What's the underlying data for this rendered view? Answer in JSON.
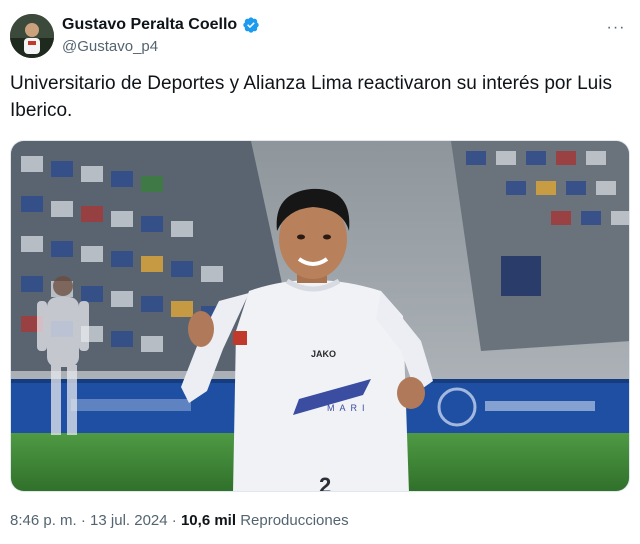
{
  "author": {
    "display_name": "Gustavo Peralta Coello",
    "handle": "@Gustavo_p4",
    "avatar_icon": "avatar",
    "verified_icon": "verified-badge-icon",
    "verified_color": "#1d9bf0"
  },
  "more_icon": "more-options-icon",
  "tweet": {
    "text": "Universitario de Deportes y Alianza Lima reactivaron su interés por Luis Iberico."
  },
  "media": {
    "jersey_text": "JAKO",
    "jersey_sponsor": "MARI",
    "number": "2",
    "colors": {
      "pitch": "#3f8a36",
      "jersey": "#f1f2f6",
      "board": "#1e4fa3"
    }
  },
  "meta": {
    "time": "8:46 p. m.",
    "separator1": "·",
    "date": "13 jul. 2024",
    "separator2": "·",
    "views_count": "10,6 mil",
    "views_label": "Reproducciones"
  }
}
